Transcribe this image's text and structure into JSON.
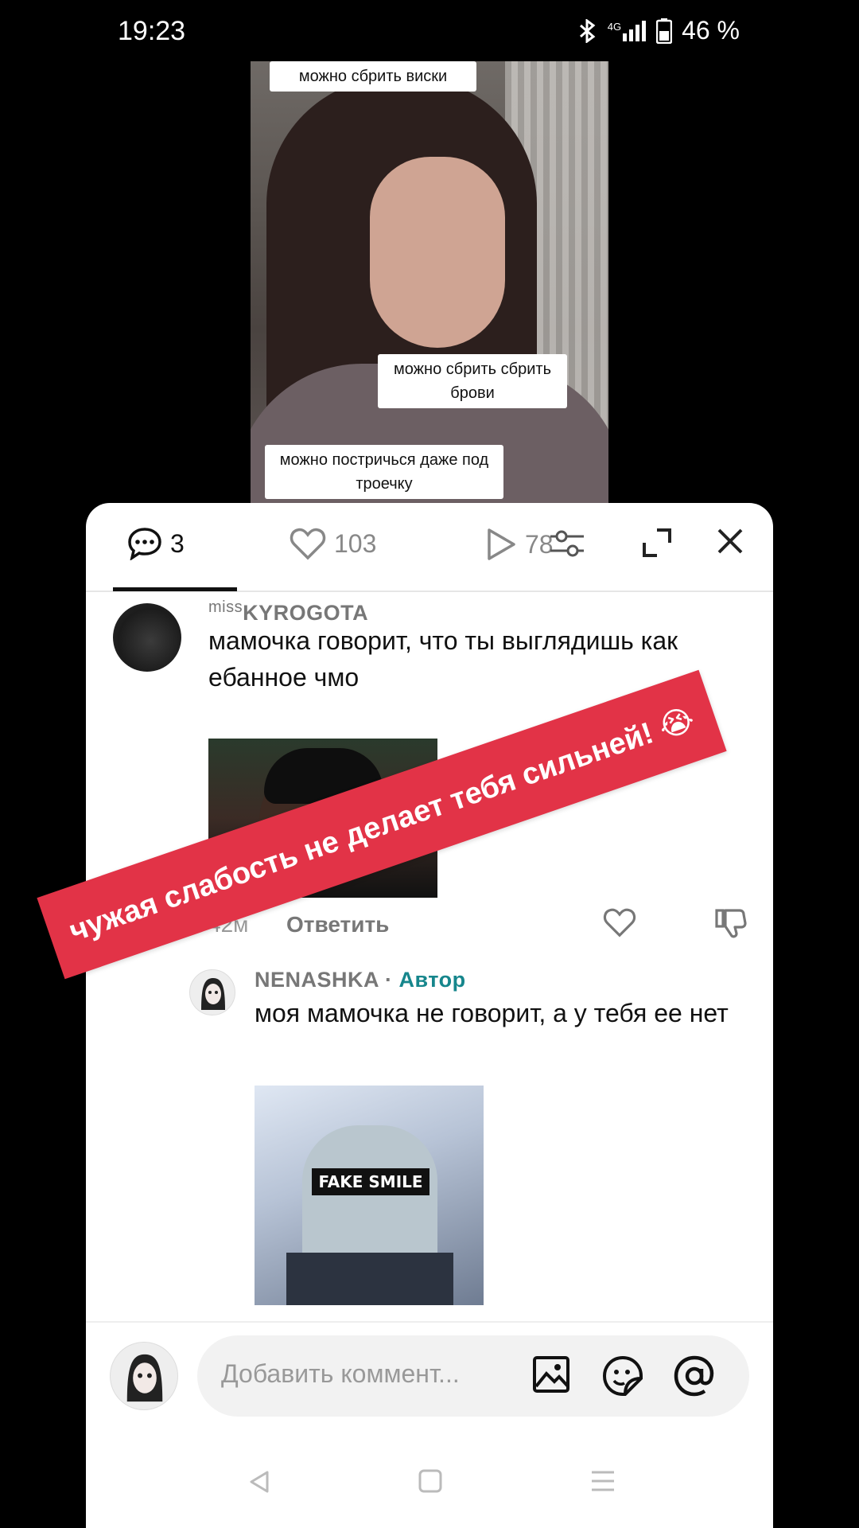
{
  "status_bar": {
    "time": "19:23",
    "network": "4G",
    "battery": "46 %"
  },
  "video": {
    "captions": [
      "можно сбрить виски",
      "можно сбрить сбрить брови",
      "можно постричься даже под троечку"
    ]
  },
  "tabs": {
    "comments_count": "3",
    "likes_count": "103",
    "views_count": "78"
  },
  "comments": [
    {
      "username_prefix": "miss",
      "username": "KYROGOTA",
      "text": "мамочка говорит, что ты выглядишь как ебанное чмо",
      "time": "42м",
      "reply_label": "Ответить"
    },
    {
      "username": "NENASHKA",
      "separator": "·",
      "author_tag": "Автор",
      "text": "моя мамочка не говорит, а у тебя ее нет",
      "image_caption": "FAKE SMILE"
    }
  ],
  "composer": {
    "placeholder": "Добавить коммент..."
  },
  "overlay": {
    "text": "чужая слабость не делает тебя сильней! 😭"
  },
  "colors": {
    "banner": "#e23347",
    "author": "#16868c"
  }
}
